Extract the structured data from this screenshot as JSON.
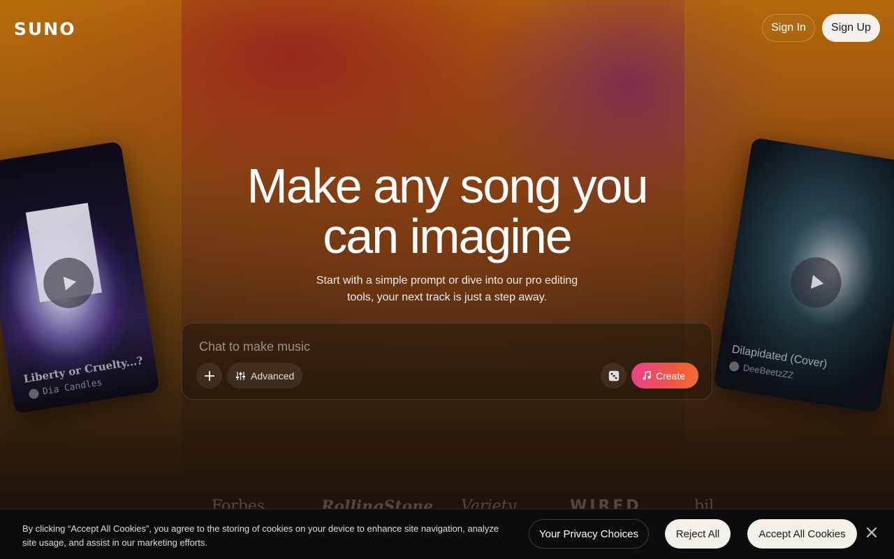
{
  "header": {
    "logo": "SUNO",
    "sign_in": "Sign In",
    "sign_up": "Sign Up"
  },
  "cards": [
    {
      "title": "Liberty or Cruelty...?",
      "artist": "Dia Candles"
    },
    {
      "title": "Dilapidated (Cover)",
      "artist": "DeeBeetzZZ"
    }
  ],
  "hero": {
    "title_line1": "Make any song you",
    "title_line2": "can imagine",
    "subtitle_line1": "Start with a simple prompt or dive into our pro editing",
    "subtitle_line2": "tools, your next track is just a step away."
  },
  "prompt": {
    "placeholder": "Chat to make music",
    "advanced_label": "Advanced",
    "create_label": "Create"
  },
  "press_logos": [
    "Forbes",
    "RollingStone",
    "Variety",
    "WIRED",
    "billboard"
  ],
  "cookie_banner": {
    "text": "By clicking “Accept All Cookies”, you agree to the storing of cookies on your device to enhance site navigation, analyze site usage, and assist in our marketing efforts.",
    "privacy_label": "Your Privacy Choices",
    "reject_label": "Reject All",
    "accept_label": "Accept All Cookies"
  },
  "colors": {
    "create_gradient_start": "#e8418c",
    "create_gradient_end": "#f26a30",
    "light_button": "#f5f0ea"
  },
  "icons": [
    "plus-icon",
    "sliders-icon",
    "dice-icon",
    "music-note-icon",
    "play-icon",
    "close-icon"
  ]
}
